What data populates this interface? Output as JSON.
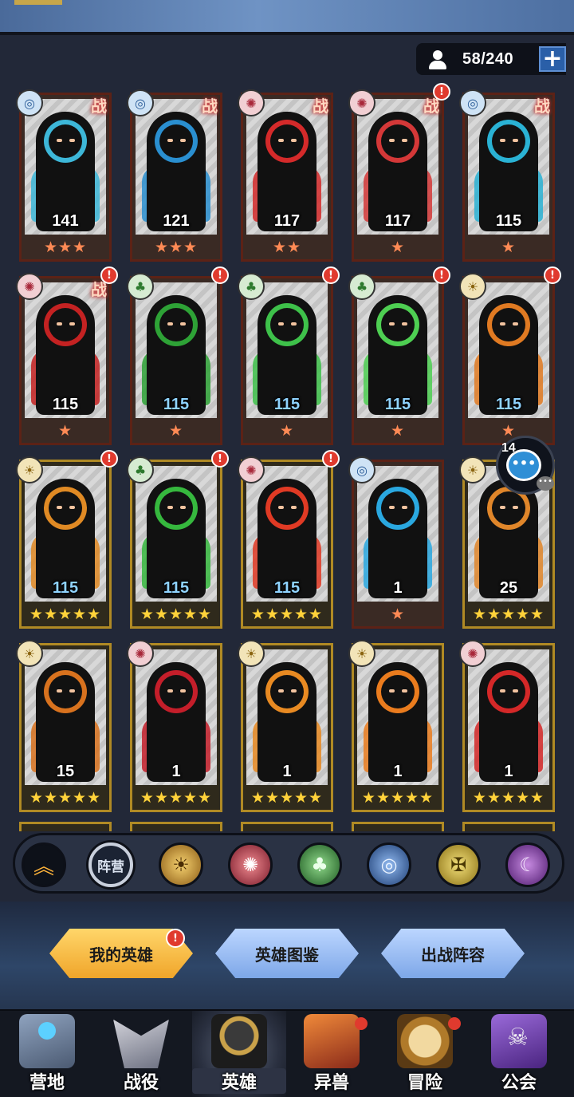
{
  "roster": {
    "count": "58/240",
    "add_label": "+"
  },
  "colors": {
    "common_stars": "#ff8a55",
    "gold_stars": "#ffd23a",
    "blue_level": "#8fd3ff",
    "accent_tab": "#f0a52a",
    "alert": "#e03a2e"
  },
  "heroes": [
    {
      "level": "141",
      "stars": "★★★",
      "faction": "water-icon",
      "battle": "战",
      "alert": "",
      "rarity": "red",
      "accent": "#3db7d8",
      "blue": false
    },
    {
      "level": "121",
      "stars": "★★★",
      "faction": "water-icon",
      "battle": "战",
      "alert": "",
      "rarity": "red",
      "accent": "#2a8fd0",
      "blue": false
    },
    {
      "level": "117",
      "stars": "★★",
      "faction": "fire-icon",
      "battle": "战",
      "alert": "",
      "rarity": "red",
      "accent": "#d42a2a",
      "blue": false
    },
    {
      "level": "117",
      "stars": "★",
      "faction": "fire-icon",
      "battle": "战",
      "alert": "!",
      "rarity": "red",
      "accent": "#d43838",
      "blue": false
    },
    {
      "level": "115",
      "stars": "★",
      "faction": "water-icon",
      "battle": "战",
      "alert": "",
      "rarity": "red",
      "accent": "#2ab2d4",
      "blue": false
    },
    {
      "level": "115",
      "stars": "★",
      "faction": "fire-icon",
      "battle": "战",
      "alert": "!",
      "rarity": "red",
      "accent": "#c42222",
      "blue": false
    },
    {
      "level": "115",
      "stars": "★",
      "faction": "forest-icon",
      "battle": "",
      "alert": "!",
      "rarity": "red",
      "accent": "#2ea236",
      "blue": true
    },
    {
      "level": "115",
      "stars": "★",
      "faction": "forest-icon",
      "battle": "",
      "alert": "!",
      "rarity": "red",
      "accent": "#3ec14a",
      "blue": true
    },
    {
      "level": "115",
      "stars": "★",
      "faction": "forest-icon",
      "battle": "",
      "alert": "!",
      "rarity": "red",
      "accent": "#4ecf52",
      "blue": true
    },
    {
      "level": "115",
      "stars": "★",
      "faction": "light-icon",
      "battle": "",
      "alert": "!",
      "rarity": "red",
      "accent": "#e07a22",
      "blue": true
    },
    {
      "level": "115",
      "stars": "★★★★★",
      "faction": "light-icon",
      "battle": "",
      "alert": "!",
      "rarity": "gold",
      "accent": "#e08a24",
      "blue": true
    },
    {
      "level": "115",
      "stars": "★★★★★",
      "faction": "forest-icon",
      "battle": "",
      "alert": "!",
      "rarity": "gold",
      "accent": "#36b83e",
      "blue": true
    },
    {
      "level": "115",
      "stars": "★★★★★",
      "faction": "fire-icon",
      "battle": "",
      "alert": "!",
      "rarity": "gold",
      "accent": "#e03a24",
      "blue": true
    },
    {
      "level": "1",
      "stars": "★",
      "faction": "water-icon",
      "battle": "",
      "alert": "",
      "rarity": "red",
      "accent": "#2aa8e0",
      "blue": false
    },
    {
      "level": "25",
      "stars": "★★★★★",
      "faction": "light-icon",
      "battle": "",
      "alert": "",
      "rarity": "gold",
      "accent": "#e0862a",
      "blue": false
    },
    {
      "level": "15",
      "stars": "★★★★★",
      "faction": "light-icon",
      "battle": "",
      "alert": "",
      "rarity": "gold",
      "accent": "#d8721e",
      "blue": false
    },
    {
      "level": "1",
      "stars": "★★★★★",
      "faction": "fire-icon",
      "battle": "",
      "alert": "",
      "rarity": "gold",
      "accent": "#c41e2a",
      "blue": false
    },
    {
      "level": "1",
      "stars": "★★★★★",
      "faction": "light-icon",
      "battle": "",
      "alert": "",
      "rarity": "gold",
      "accent": "#e88a22",
      "blue": false
    },
    {
      "level": "1",
      "stars": "★★★★★",
      "faction": "light-icon",
      "battle": "",
      "alert": "",
      "rarity": "gold",
      "accent": "#ea7c1e",
      "blue": false
    },
    {
      "level": "1",
      "stars": "★★★★★",
      "faction": "fire-icon",
      "battle": "",
      "alert": "",
      "rarity": "gold",
      "accent": "#d42828",
      "blue": false
    }
  ],
  "chat": {
    "unread": "14",
    "bubble": "•••",
    "more": "•••"
  },
  "filter": {
    "collapse_icon": "︽",
    "camp_label": "阵营",
    "factions": [
      {
        "name": "light-faction-icon",
        "glyph": "☀"
      },
      {
        "name": "fire-faction-icon",
        "glyph": "✺"
      },
      {
        "name": "forest-faction-icon",
        "glyph": "♣"
      },
      {
        "name": "water-faction-icon",
        "glyph": "◎"
      },
      {
        "name": "holy-faction-icon",
        "glyph": "✠"
      },
      {
        "name": "shadow-faction-icon",
        "glyph": "☾"
      }
    ]
  },
  "tabs": {
    "mine": "我的英雄",
    "codex": "英雄图鉴",
    "lineup": "出战阵容",
    "mine_alert": "!"
  },
  "nav": [
    {
      "label": "营地",
      "icon": "camp-icon",
      "dot": false,
      "active": false
    },
    {
      "label": "战役",
      "icon": "campaign-icon",
      "dot": false,
      "active": false
    },
    {
      "label": "英雄",
      "icon": "hero-helmet-icon",
      "dot": false,
      "active": true
    },
    {
      "label": "异兽",
      "icon": "beast-icon",
      "dot": true,
      "active": false
    },
    {
      "label": "冒险",
      "icon": "compass-icon",
      "dot": true,
      "active": false
    },
    {
      "label": "公会",
      "icon": "guild-banner-icon",
      "dot": false,
      "active": false
    }
  ]
}
